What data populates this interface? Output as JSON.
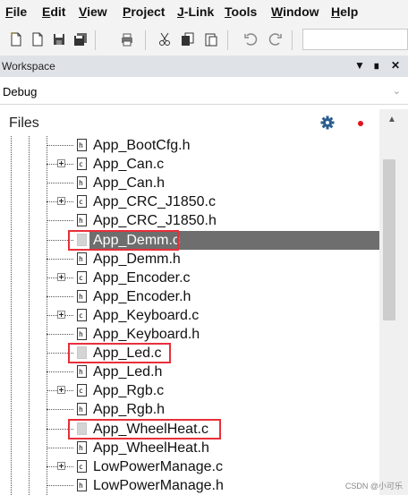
{
  "menu": [
    "File",
    "Edit",
    "View",
    "Project",
    "J-Link",
    "Tools",
    "Window",
    "Help"
  ],
  "toolbar": {
    "icons": [
      "new-file-icon",
      "new-project-icon",
      "save-icon",
      "save-all-icon",
      "print-icon",
      "cut-icon",
      "copy-icon",
      "paste-icon",
      "undo-icon",
      "redo-icon"
    ]
  },
  "workspace": {
    "title": "Workspace",
    "configuration": "Debug",
    "files_label": "Files"
  },
  "files": [
    {
      "name": "App_BootCfg.h",
      "type": "h",
      "expandable": false,
      "selected": false
    },
    {
      "name": "App_Can.c",
      "type": "c",
      "expandable": true,
      "selected": false
    },
    {
      "name": "App_Can.h",
      "type": "h",
      "expandable": false,
      "selected": false
    },
    {
      "name": "App_CRC_J1850.c",
      "type": "c",
      "expandable": true,
      "selected": false
    },
    {
      "name": "App_CRC_J1850.h",
      "type": "h",
      "expandable": false,
      "selected": false
    },
    {
      "name": "App_Demm.c",
      "type": "blank",
      "expandable": false,
      "selected": true,
      "highlighted": true
    },
    {
      "name": "App_Demm.h",
      "type": "h",
      "expandable": false,
      "selected": false
    },
    {
      "name": "App_Encoder.c",
      "type": "c",
      "expandable": true,
      "selected": false
    },
    {
      "name": "App_Encoder.h",
      "type": "h",
      "expandable": false,
      "selected": false
    },
    {
      "name": "App_Keyboard.c",
      "type": "c",
      "expandable": true,
      "selected": false
    },
    {
      "name": "App_Keyboard.h",
      "type": "h",
      "expandable": false,
      "selected": false
    },
    {
      "name": "App_Led.c",
      "type": "blank",
      "expandable": false,
      "selected": false,
      "highlighted": true
    },
    {
      "name": "App_Led.h",
      "type": "h",
      "expandable": false,
      "selected": false
    },
    {
      "name": "App_Rgb.c",
      "type": "c",
      "expandable": true,
      "selected": false
    },
    {
      "name": "App_Rgb.h",
      "type": "h",
      "expandable": false,
      "selected": false
    },
    {
      "name": "App_WheelHeat.c",
      "type": "blank",
      "expandable": false,
      "selected": false,
      "highlighted": true
    },
    {
      "name": "App_WheelHeat.h",
      "type": "h",
      "expandable": false,
      "selected": false
    },
    {
      "name": "LowPowerManage.c",
      "type": "c",
      "expandable": true,
      "selected": false
    },
    {
      "name": "LowPowerManage.h",
      "type": "h",
      "expandable": false,
      "selected": false
    }
  ],
  "watermark": "CSDN @小可乐",
  "colors": {
    "selection": "#6e6e6e",
    "highlight_box": "#e8303a",
    "status_dot": "#e0141c",
    "gear": "#2a5d8f"
  }
}
